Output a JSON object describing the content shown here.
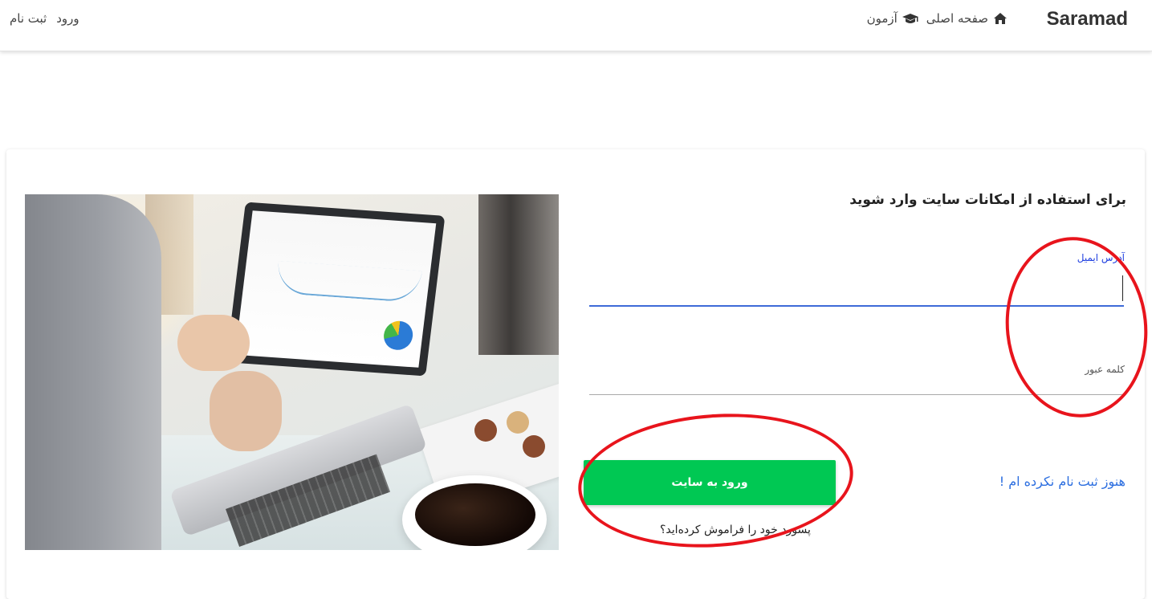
{
  "navbar": {
    "brand": "Saramad",
    "home_label": "صفحه اصلی",
    "exam_label": "آزمون",
    "login_label": "ورود",
    "register_label": "ثبت نام",
    "icons": {
      "home": "home-icon",
      "exam": "graduation-cap-icon"
    }
  },
  "login_form": {
    "title": "برای استفاده از امکانات سایت وارد شوید",
    "email_label": "آدرس ایمیل",
    "email_value": "",
    "password_label": "کلمه عبور",
    "password_value": "",
    "submit_label": "ورود به سایت",
    "forgot_password": "پسورد خود را فراموش کرده‌اید؟",
    "register_link": "هنوز ثبت نام نکرده ام !"
  },
  "colors": {
    "accent": "#3e6ad8",
    "email_label": "#1f3fe0",
    "button_bg": "#00c853",
    "register_link": "#2d6fe0",
    "annotation": "#e8141c"
  }
}
